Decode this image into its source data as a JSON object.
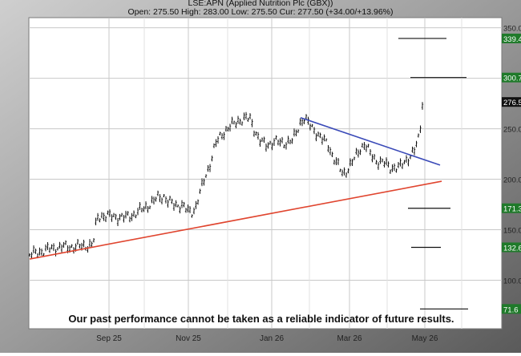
{
  "chart_data": {
    "type": "candlestick",
    "title": "LSE:APN (Applied Nutrition Plc (GBX))",
    "subtitle": "Open: 275.50 High: 283.00 Low: 275.50 Cur: 277.50 (+34.00/+13.96%)",
    "x_labels": [
      "Sep 25",
      "Nov 25",
      "Jan 26",
      "Mar 26",
      "May 26"
    ],
    "y_ticks": [
      "350.0",
      "300.0",
      "250.0",
      "200.0",
      "150.0",
      "100.0"
    ],
    "ylim": [
      52,
      360
    ],
    "grid": true,
    "price_path": [
      [
        0,
        125
      ],
      [
        12,
        128
      ],
      [
        25,
        131
      ],
      [
        40,
        133
      ],
      [
        55,
        133
      ],
      [
        68,
        134
      ],
      [
        78,
        135
      ],
      [
        80,
        140
      ],
      [
        84,
        162
      ],
      [
        90,
        164
      ],
      [
        105,
        163
      ],
      [
        118,
        162
      ],
      [
        130,
        165
      ],
      [
        140,
        170
      ],
      [
        150,
        175
      ],
      [
        160,
        182
      ],
      [
        168,
        183
      ],
      [
        172,
        178
      ],
      [
        180,
        175
      ],
      [
        190,
        174
      ],
      [
        198,
        168
      ],
      [
        203,
        168
      ],
      [
        207,
        172
      ],
      [
        212,
        185
      ],
      [
        218,
        200
      ],
      [
        225,
        215
      ],
      [
        232,
        235
      ],
      [
        240,
        245
      ],
      [
        250,
        252
      ],
      [
        260,
        258
      ],
      [
        270,
        260
      ],
      [
        275,
        260
      ],
      [
        280,
        250
      ],
      [
        287,
        238
      ],
      [
        295,
        234
      ],
      [
        305,
        237
      ],
      [
        318,
        236
      ],
      [
        328,
        238
      ],
      [
        333,
        247
      ],
      [
        338,
        257
      ],
      [
        343,
        260
      ],
      [
        348,
        255
      ],
      [
        356,
        248
      ],
      [
        364,
        240
      ],
      [
        372,
        235
      ],
      [
        378,
        223
      ],
      [
        385,
        213
      ],
      [
        391,
        205
      ],
      [
        397,
        210
      ],
      [
        405,
        220
      ],
      [
        412,
        230
      ],
      [
        418,
        235
      ],
      [
        425,
        225
      ],
      [
        433,
        218
      ],
      [
        442,
        216
      ],
      [
        450,
        212
      ],
      [
        457,
        211
      ],
      [
        462,
        212
      ],
      [
        468,
        218
      ],
      [
        474,
        222
      ],
      [
        480,
        228
      ],
      [
        485,
        240
      ],
      [
        488,
        255
      ],
      [
        490,
        276
      ],
      [
        492,
        280
      ]
    ],
    "trendlines": [
      {
        "color": "#e0452f",
        "points": [
          [
            0,
            121
          ],
          [
            514,
            198
          ]
        ]
      },
      {
        "color": "#3a4ab8",
        "points": [
          [
            338,
            261
          ],
          [
            512,
            214
          ]
        ]
      }
    ],
    "target_lines": [
      {
        "color": "#111111",
        "y": 339.4,
        "label": "339.4",
        "label_bg": "#1f7a2a",
        "x_start": 460,
        "x_end": 520
      },
      {
        "color": "#111111",
        "y": 300.7,
        "label": "300.7",
        "label_bg": "#1f7a2a",
        "x_start": 475,
        "x_end": 545
      },
      {
        "color": "#111111",
        "y": 171.3,
        "label": "171.3",
        "label_bg": "#1f7a2a",
        "x_start": 472,
        "x_end": 525
      },
      {
        "color": "#111111",
        "y": 132.6,
        "label": "132.6",
        "label_bg": "#1f7a2a",
        "x_start": 476,
        "x_end": 513
      },
      {
        "color": "#111111",
        "y": 71.6,
        "label": "71.6",
        "label_bg": "#1f7a2a",
        "x_start": 487,
        "x_end": 547
      }
    ],
    "current_price": {
      "label": "276.5",
      "value": 276.5,
      "label_bg": "#111111"
    },
    "disclaimer": "Our past performance cannot be taken as a reliable indicator of future results."
  }
}
